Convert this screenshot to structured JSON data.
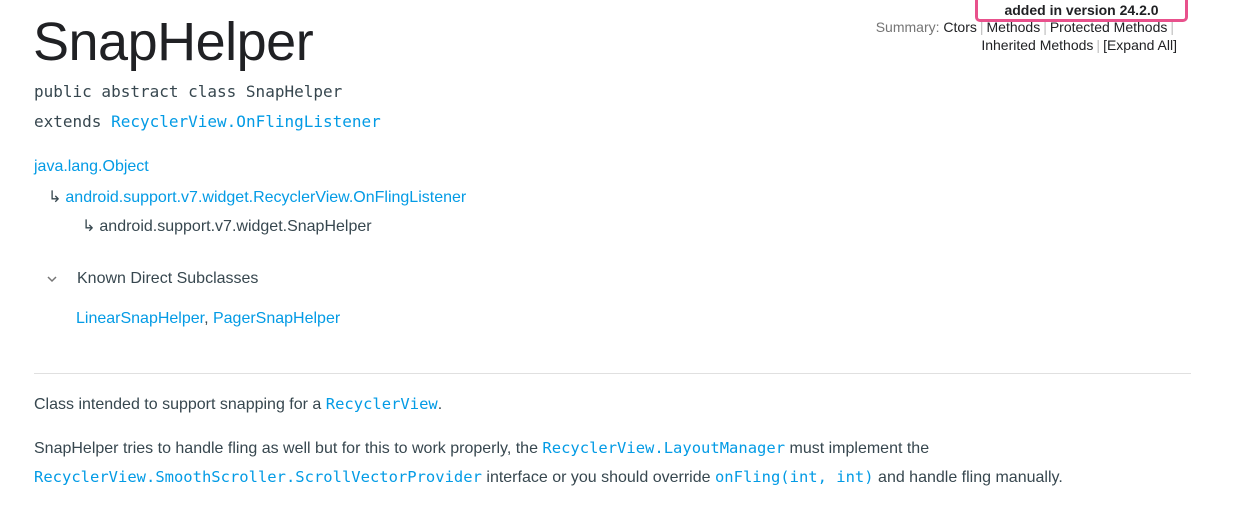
{
  "header": {
    "title": "SnapHelper",
    "version_badge": "added in version 24.2.0"
  },
  "summary_nav": {
    "label": "Summary:",
    "items": [
      "Ctors",
      "Methods",
      "Protected Methods",
      "Inherited Methods",
      "[Expand All]"
    ]
  },
  "declaration": {
    "line1": "public abstract class SnapHelper",
    "extends_keyword": "extends",
    "extends_link": "RecyclerView.OnFlingListener"
  },
  "hierarchy": {
    "root": "java.lang.Object",
    "level1": "android.support.v7.widget.RecyclerView.OnFlingListener",
    "level2": "android.support.v7.widget.SnapHelper",
    "arrow": "↳"
  },
  "subclasses": {
    "header": "Known Direct Subclasses",
    "items": [
      "LinearSnapHelper",
      "PagerSnapHelper"
    ],
    "separator": ", "
  },
  "description": {
    "p1_text": "Class intended to support snapping for a ",
    "p1_link": "RecyclerView",
    "p1_end": ".",
    "p2_text1": "SnapHelper tries to handle fling as well but for this to work properly, the ",
    "p2_link1": "RecyclerView.LayoutManager",
    "p2_text2": " must implement the",
    "p2_link2": "RecyclerView.SmoothScroller.ScrollVectorProvider",
    "p2_text3": " interface or you should override ",
    "p2_link3": "onFling(int, int)",
    "p2_text4": " and handle fling manually."
  },
  "colors": {
    "link": "#039be5",
    "badge_border": "#e8518c",
    "text": "#37474f"
  }
}
